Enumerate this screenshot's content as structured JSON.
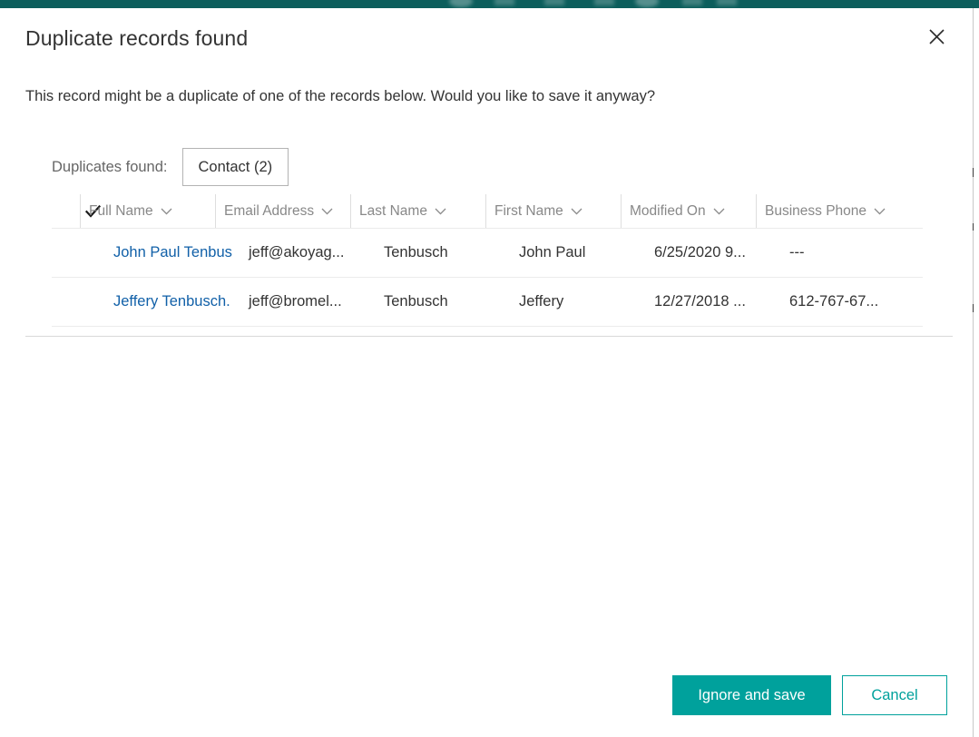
{
  "theme": {
    "accent": "#00a19c",
    "app_bar": "#0c5e5c",
    "link": "#1160a8",
    "text": "#333333",
    "muted": "#888888"
  },
  "dialog": {
    "title": "Duplicate records found",
    "subtitle": "This record might be a duplicate of one of the records below. Would you like to save it anyway?",
    "close_icon": "close-icon",
    "duplicates_label": "Duplicates found:",
    "entity_tabs": [
      {
        "label": "Contact (2)",
        "selected": true
      }
    ]
  },
  "grid": {
    "select_all_icon": "checkmark-icon",
    "sort_icon": "chevron-down-icon",
    "columns": [
      {
        "key": "full_name",
        "label": "Full Name"
      },
      {
        "key": "email_address",
        "label": "Email Address"
      },
      {
        "key": "last_name",
        "label": "Last Name"
      },
      {
        "key": "first_name",
        "label": "First Name"
      },
      {
        "key": "modified_on",
        "label": "Modified On"
      },
      {
        "key": "business_phone",
        "label": "Business Phone"
      }
    ],
    "rows": [
      {
        "full_name": "John Paul Tenbus",
        "email_address": "jeff@akoyag...",
        "last_name": "Tenbusch",
        "first_name": "John Paul",
        "modified_on": "6/25/2020 9...",
        "business_phone": "---"
      },
      {
        "full_name": "Jeffery Tenbusch.",
        "email_address": "jeff@bromel...",
        "last_name": "Tenbusch",
        "first_name": "Jeffery",
        "modified_on": "12/27/2018 ...",
        "business_phone": "612-767-67..."
      }
    ]
  },
  "footer": {
    "primary_label": "Ignore and save",
    "secondary_label": "Cancel"
  }
}
